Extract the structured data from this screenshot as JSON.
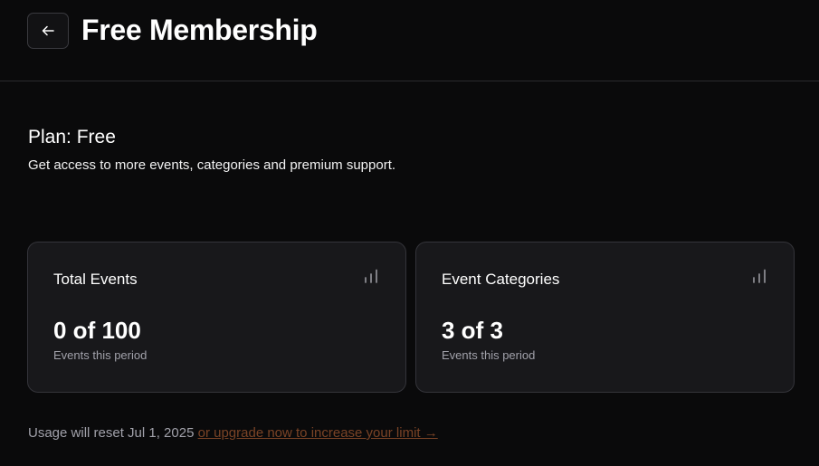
{
  "header": {
    "title": "Free Membership",
    "back_icon": "arrow-left-icon"
  },
  "plan": {
    "title": "Plan: Free",
    "description": "Get access to more events, categories and premium support."
  },
  "cards": [
    {
      "title": "Total Events",
      "value": "0 of 100",
      "subtitle": "Events this period",
      "icon": "bar-chart-icon"
    },
    {
      "title": "Event Categories",
      "value": "3 of 3",
      "subtitle": "Events this period",
      "icon": "bar-chart-icon"
    }
  ],
  "footer": {
    "text": "Usage will reset Jul 1, 2025",
    "link_text": "or upgrade now to increase your limit →"
  },
  "colors": {
    "background": "#0a0a0b",
    "card": "#18181b",
    "link": "#7a4326",
    "muted": "#a1a1aa"
  }
}
